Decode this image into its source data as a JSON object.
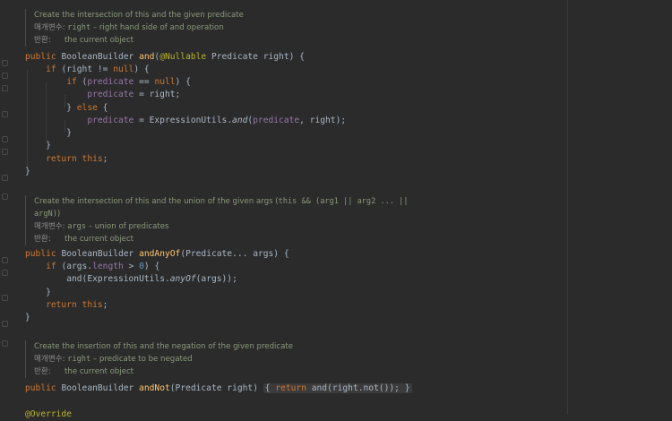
{
  "doc1": {
    "summary": "Create the intersection of this and the given predicate",
    "param_label": "매개변수:",
    "param_name": "right",
    "param_desc": " – right hand side of and operation",
    "return_label": "반환:",
    "return_desc": "the current object"
  },
  "doc2": {
    "summary_line1": "Create the intersection of this and the union of the given args (",
    "summary_code": "this && (arg1 || arg2 ... ||",
    "summary_line2_code": "argN)",
    "summary_line2_tail": ")",
    "param_label": "매개변수:",
    "param_name": "args",
    "param_desc": " – union of predicates",
    "return_label": "반환:",
    "return_desc": "the current object"
  },
  "doc3": {
    "summary": "Create the insertion of this and the negation of the given predicate",
    "param_label": "매개변수:",
    "param_name": "right",
    "param_desc": " – predicate to be negated",
    "return_label": "반환:",
    "return_desc": "the current object"
  },
  "code": {
    "public": "public",
    "class_name": "BooleanBuilder",
    "m_and": "and",
    "nullable": "@Nullable",
    "predicate_type": "Predicate",
    "right": "right",
    "if": "if",
    "null": "null",
    "predicate_field": "predicate",
    "else": "else",
    "expr_utils": "ExpressionUtils",
    "return": "return",
    "this": "this",
    "m_and_any_of": "andAnyOf",
    "args": "args",
    "length": "length",
    "zero": "0",
    "any_of": "anyOf",
    "m_and_not": "andNot",
    "not": "not",
    "override": "@Override"
  }
}
